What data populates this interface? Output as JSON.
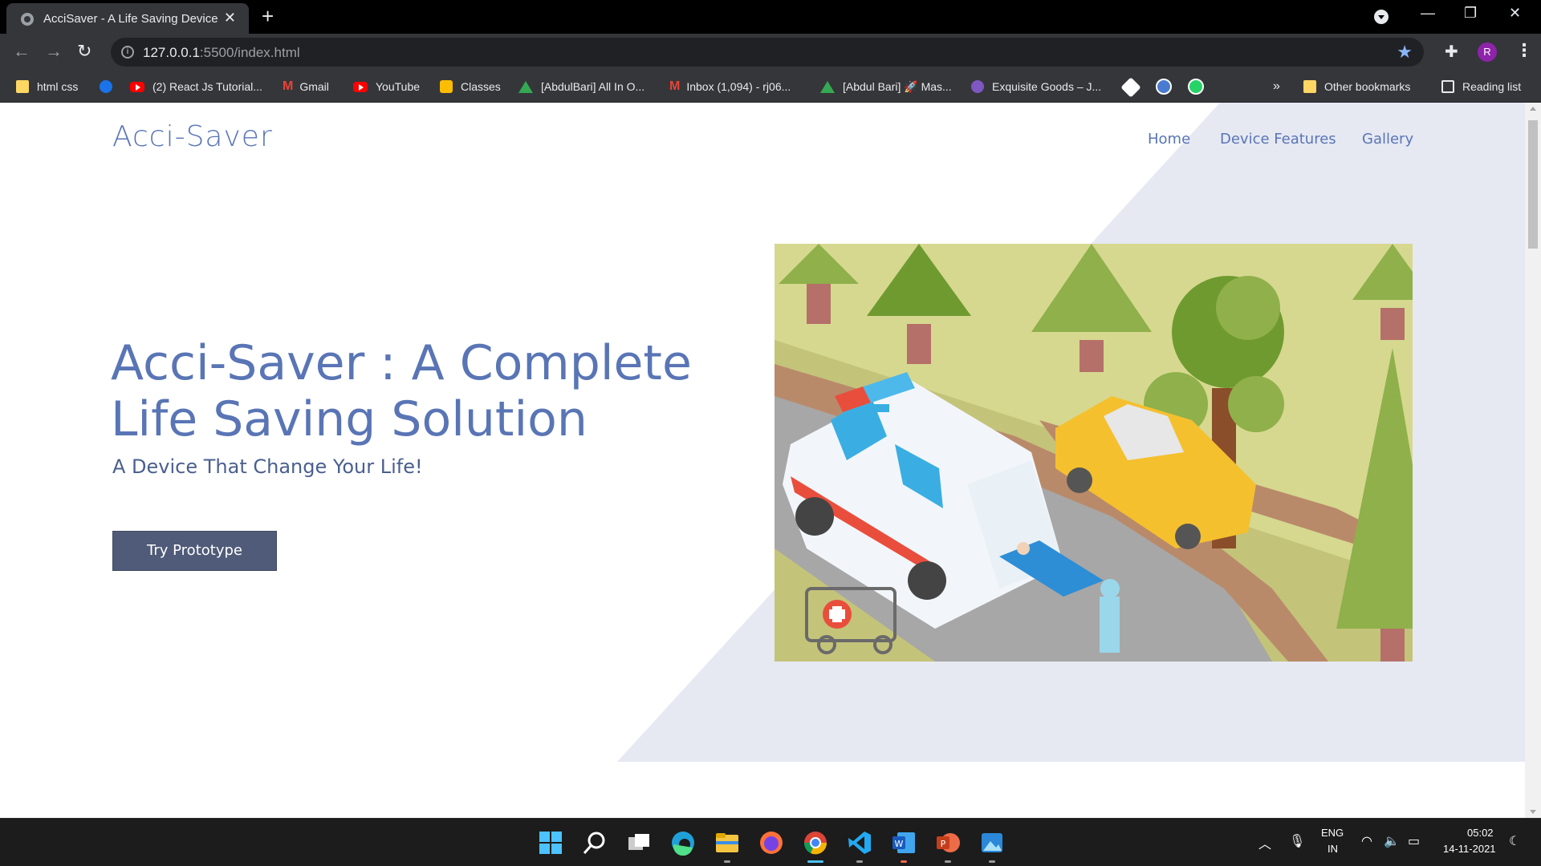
{
  "browser": {
    "tab_title": "AcciSaver - A Life Saving Device",
    "tab_close": "✕",
    "new_tab": "+",
    "url_host": "127.0.0.1",
    "url_path": ":5500/index.html",
    "profile_initial": "R",
    "window_controls": {
      "minimize": "—",
      "restore": "❐",
      "close": "✕"
    },
    "nav": {
      "back": "←",
      "forward": "→",
      "reload": "↻"
    },
    "bookmarks": [
      {
        "label": "html css",
        "icon": "folder-icon"
      },
      {
        "label": "",
        "icon": "cloud-icon"
      },
      {
        "label": "(2) React Js Tutorial...",
        "icon": "youtube-icon"
      },
      {
        "label": "Gmail",
        "icon": "gmail-icon"
      },
      {
        "label": "YouTube",
        "icon": "youtube-icon"
      },
      {
        "label": "Classes",
        "icon": "classroom-icon"
      },
      {
        "label": "[AbdulBari] All In O...",
        "icon": "drive-icon"
      },
      {
        "label": "Inbox (1,094) - rj06...",
        "icon": "gmail-icon"
      },
      {
        "label": "[Abdul Bari] 🚀 Mas...",
        "icon": "drive-icon"
      },
      {
        "label": "Exquisite Goods – J...",
        "icon": "bag-icon"
      }
    ],
    "bookmarks_overflow": "»",
    "other_bookmarks": "Other bookmarks",
    "reading_list": "Reading list"
  },
  "site": {
    "logo": "Acci-Saver",
    "nav": [
      "Home",
      "Device Features",
      "Gallery"
    ],
    "hero_title": "Acci-Saver : A Complete Life Saving Solution",
    "hero_subtitle": "A Device That Change Your Life!",
    "cta_label": "Try Prototype"
  },
  "taskbar": {
    "lang_line1": "ENG",
    "lang_line2": "IN",
    "time": "05:02",
    "date": "14-11-2021"
  },
  "colors": {
    "brand": "#5975b5",
    "button": "#4f5b78",
    "bg_shape": "#e6e9f2"
  }
}
